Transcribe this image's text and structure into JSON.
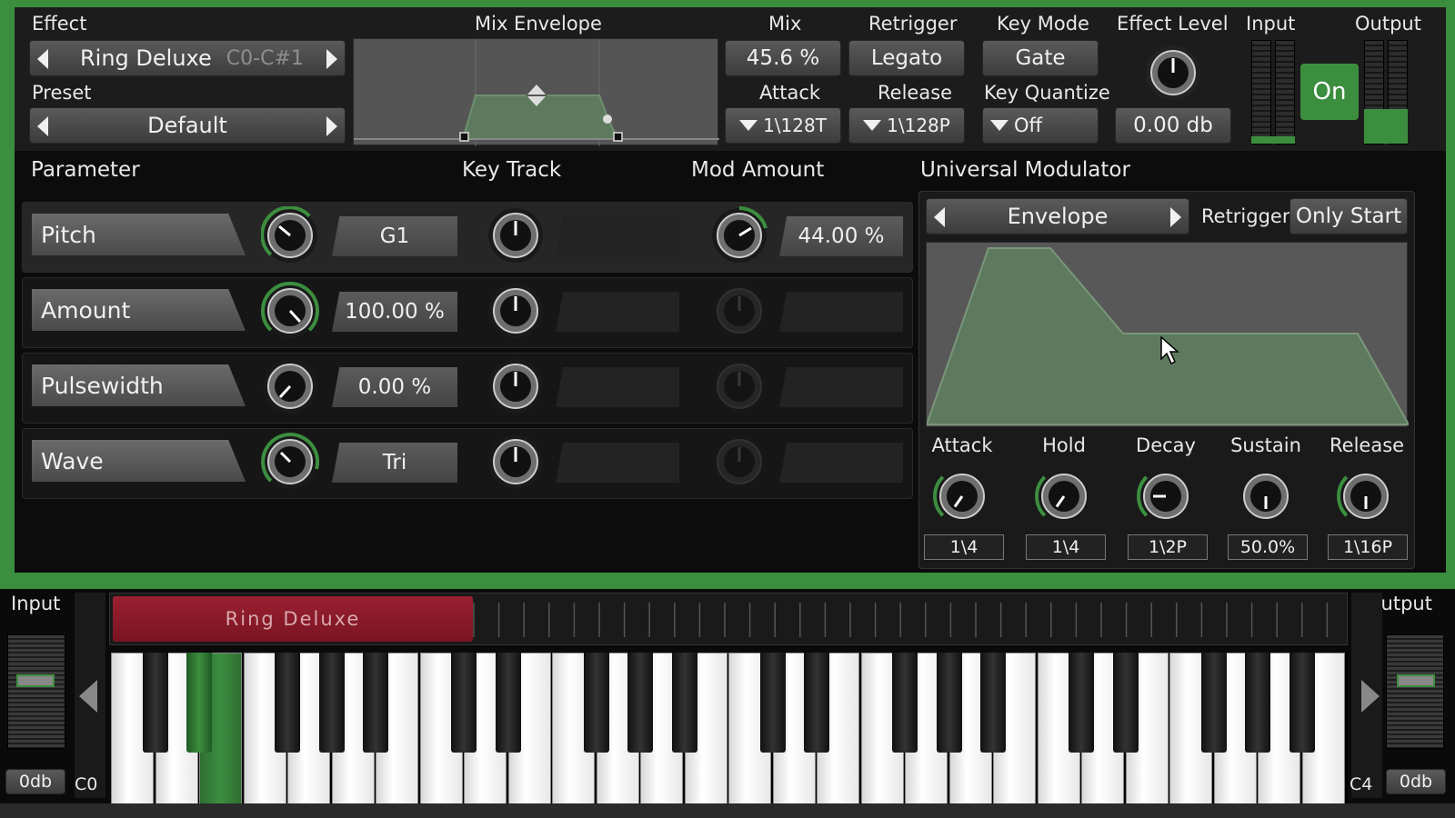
{
  "header": {
    "effect_label": "Effect",
    "effect_name": "Ring Deluxe",
    "effect_range": "C0-C#1",
    "preset_label": "Preset",
    "preset_name": "Default",
    "mix_envelope_label": "Mix Envelope",
    "mix_label": "Mix",
    "mix_value": "45.6 %",
    "attack_label": "Attack",
    "attack_value": "1\\128T",
    "retrigger_label": "Retrigger",
    "retrigger_value": "Legato",
    "release_label": "Release",
    "release_value": "1\\128P",
    "key_mode_label": "Key Mode",
    "key_mode_value": "Gate",
    "key_quantize_label": "Key Quantize",
    "key_quantize_value": "Off",
    "effect_level_label": "Effect Level",
    "effect_level_value": "0.00 db",
    "input_label": "Input",
    "output_label": "Output",
    "on_button": "On"
  },
  "params": {
    "parameter_header": "Parameter",
    "key_track_header": "Key Track",
    "mod_amount_header": "Mod Amount",
    "rows": [
      {
        "name": "Pitch",
        "value": "G1",
        "mod_value": "44.00 %"
      },
      {
        "name": "Amount",
        "value": "100.00 %",
        "mod_value": ""
      },
      {
        "name": "Pulsewidth",
        "value": "0.00 %",
        "mod_value": ""
      },
      {
        "name": "Wave",
        "value": "Tri",
        "mod_value": ""
      }
    ]
  },
  "modulator": {
    "title": "Universal Modulator",
    "type": "Envelope",
    "retrigger_label": "Retrigger",
    "retrigger_value": "Only Start",
    "knobs": [
      {
        "label": "Attack",
        "value": "1\\4"
      },
      {
        "label": "Hold",
        "value": "1\\4"
      },
      {
        "label": "Decay",
        "value": "1\\2P"
      },
      {
        "label": "Sustain",
        "value": "50.0%"
      },
      {
        "label": "Release",
        "value": "1\\16P"
      }
    ]
  },
  "keyboard": {
    "input_label": "Input",
    "output_label": "Output",
    "input_db": "0db",
    "output_db": "0db",
    "low_note": "C0",
    "high_note": "C4",
    "zone_name": "Ring Deluxe"
  },
  "colors": {
    "accent_green": "#3c8e3f",
    "zone_red": "#8b1a26",
    "env_fill": "#5e7a5e"
  }
}
